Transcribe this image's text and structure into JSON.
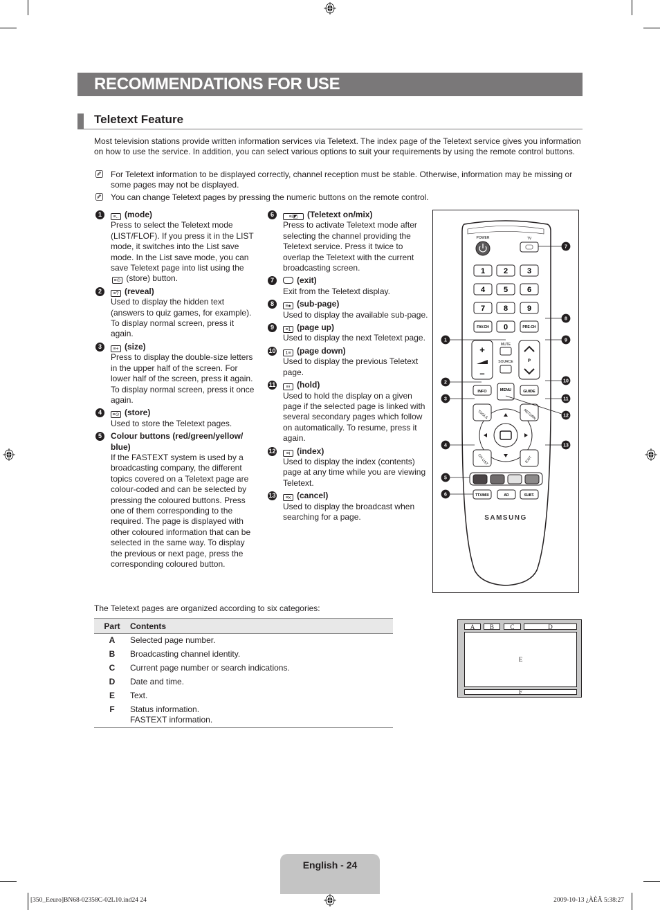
{
  "page": {
    "title": "RECOMMENDATIONS FOR USE",
    "section_title": "Teletext Feature",
    "intro": "Most television stations provide written information services via Teletext. The index page of the Teletext service gives you information on how to use the service. In addition, you can select various options to suit your requirements by using the remote control buttons.",
    "notes": [
      "For Teletext information to be displayed correctly, channel reception must be stable. Otherwise, information may be missing or some pages may not be displayed.",
      "You can change Teletext pages by pressing the numeric buttons on the remote control."
    ]
  },
  "items": [
    {
      "num": "1",
      "icon": "≡..",
      "label": "(mode)",
      "text_a": "Press to select the Teletext mode (LIST/FLOF). If you press it in the LIST mode, it switches into the List save mode. In the List save mode, you can save Teletext page into list using the",
      "inline_icon": "≡⊙",
      "text_b": "(store) button."
    },
    {
      "num": "2",
      "icon": "≡?",
      "label": "(reveal)",
      "text": "Used to display the hidden text (answers to quiz games, for example). To display normal screen, press it again."
    },
    {
      "num": "3",
      "icon": "≡+",
      "label": "(size)",
      "text": "Press to display the double-size letters in the upper half of the screen. For lower half of the screen, press it again. To display normal screen, press it once again."
    },
    {
      "num": "4",
      "icon": "≡⊙",
      "label": "(store)",
      "text": "Used to store the Teletext pages."
    },
    {
      "num": "5",
      "label": "Colour buttons (red/green/yellow/ blue)",
      "text": "If the FASTEXT system is used by a broadcasting company, the different topics covered on a Teletext page are colour-coded and can be selected by pressing the coloured buttons. Press one of them corresponding to the required. The page is displayed with other coloured information that can be selected in the same way. To display the previous or next page, press the corresponding coloured button."
    },
    {
      "num": "6",
      "icon": "≡/◩",
      "label": "(Teletext on/mix)",
      "text": "Press to activate Teletext mode after selecting the channel providing the Teletext service. Press it twice to overlap the Teletext with the current broadcasting screen."
    },
    {
      "num": "7",
      "icon": " ",
      "label": "(exit)",
      "text": "Exit from the Teletext display."
    },
    {
      "num": "8",
      "icon": "≡●",
      "label": "(sub-page)",
      "text": "Used to display the available sub-page."
    },
    {
      "num": "9",
      "icon": "≡1",
      "label": "(page up)",
      "text": "Used to display the next Teletext page."
    },
    {
      "num": "10",
      "icon": "1≡",
      "label": "(page down)",
      "text": "Used to display the previous Teletext page."
    },
    {
      "num": "11",
      "icon": "≡⁝",
      "label": "(hold)",
      "text": "Used to hold the display on a given page if the selected page is linked with several secondary pages which follow on automatically. To resume, press it again."
    },
    {
      "num": "12",
      "icon": "≡i",
      "label": "(index)",
      "text": "Used to display the index (contents) page at any time while you are viewing Teletext."
    },
    {
      "num": "13",
      "icon": "≡x",
      "label": "(cancel)",
      "text": "Used to display the broadcast when searching for a page."
    }
  ],
  "remote": {
    "power": "POWER",
    "tv": "TV",
    "keys": [
      "1",
      "2",
      "3",
      "4",
      "5",
      "6",
      "7",
      "8",
      "9",
      "FAV.CH",
      "0",
      "PRE-CH"
    ],
    "mute": "MUTE",
    "source": "SOURCE",
    "p": "P",
    "info": "INFO",
    "menu": "MENU",
    "guide": "GUIDE",
    "tools": "TOOLS",
    "return": "RETURN",
    "chlist": "CH LIST",
    "exit": "EXIT",
    "ttx": "TTX/MIX",
    "ad": "AD",
    "subt": "SUBT.",
    "brand": "SAMSUNG",
    "colour_buttons": [
      "#4a4446",
      "#6f6b6c",
      "#e3e3e3",
      "#8c8a8a"
    ],
    "callouts": [
      "7",
      "8",
      "1",
      "9",
      "2",
      "10",
      "3",
      "11",
      "12",
      "4",
      "13",
      "5",
      "6"
    ]
  },
  "table": {
    "intro": "The Teletext pages are organized according to six categories:",
    "headers": [
      "Part",
      "Contents"
    ],
    "rows": [
      {
        "part": "A",
        "content": "Selected page number."
      },
      {
        "part": "B",
        "content": "Broadcasting channel identity."
      },
      {
        "part": "C",
        "content": "Current page number or search indications."
      },
      {
        "part": "D",
        "content": "Date and time."
      },
      {
        "part": "E",
        "content": "Text."
      },
      {
        "part": "F",
        "content": "Status information.",
        "content2": "FASTEXT information."
      }
    ]
  },
  "diagram": {
    "a": "A",
    "b": "B",
    "c": "C",
    "d": "D",
    "e": "E",
    "f": "F"
  },
  "footer": {
    "page_label": "English - 24",
    "slug_left": "[350_Eeuro]BN68-02358C-02L10.ind24   24",
    "slug_right": "2009-10-13   ¿ÀÈÄ 5:38:27"
  }
}
